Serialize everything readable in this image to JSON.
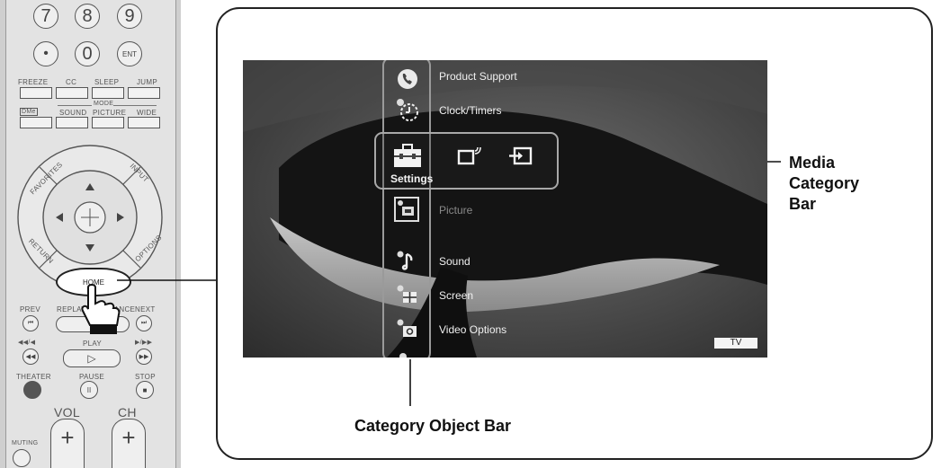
{
  "remote": {
    "number_keys": [
      "7",
      "8",
      "9",
      "•",
      "0",
      "ENT"
    ],
    "row1_labels": [
      "FREEZE",
      "CC",
      "SLEEP",
      "JUMP"
    ],
    "row2_labels": [
      "DMe",
      "SOUND",
      "PICTURE",
      "WIDE"
    ],
    "mode_label": "MODE",
    "ring_labels": {
      "favorites": "FAVORITES",
      "input": "INPUT",
      "return": "RETURN",
      "options": "OPTIONS"
    },
    "home_label": "HOME",
    "transport_labels": [
      "PREV",
      "REPLAY",
      "ADVANCE",
      "NEXT"
    ],
    "play_label": "PLAY",
    "theater_labels": [
      "THEATER",
      "PAUSE",
      "STOP"
    ],
    "vol_label": "VOL",
    "ch_label": "CH",
    "muting_label": "MUTING"
  },
  "screen": {
    "menu_items": [
      {
        "label": "Product Support",
        "icon": "phone-icon"
      },
      {
        "label": "Clock/Timers",
        "icon": "clock-icon"
      },
      {
        "label": "Picture",
        "icon": "picture-icon"
      },
      {
        "label": "Sound",
        "icon": "music-note-icon"
      },
      {
        "label": "Screen",
        "icon": "screen-icon"
      },
      {
        "label": "Video Options",
        "icon": "video-options-icon"
      }
    ],
    "media_category": {
      "selected_label": "Settings",
      "icons": [
        "toolbox-icon",
        "tv-signal-icon",
        "input-icon"
      ]
    },
    "source_badge": "TV"
  },
  "callouts": {
    "media_category_bar": [
      "Media",
      "Category",
      "Bar"
    ],
    "category_object_bar": "Category Object Bar"
  }
}
